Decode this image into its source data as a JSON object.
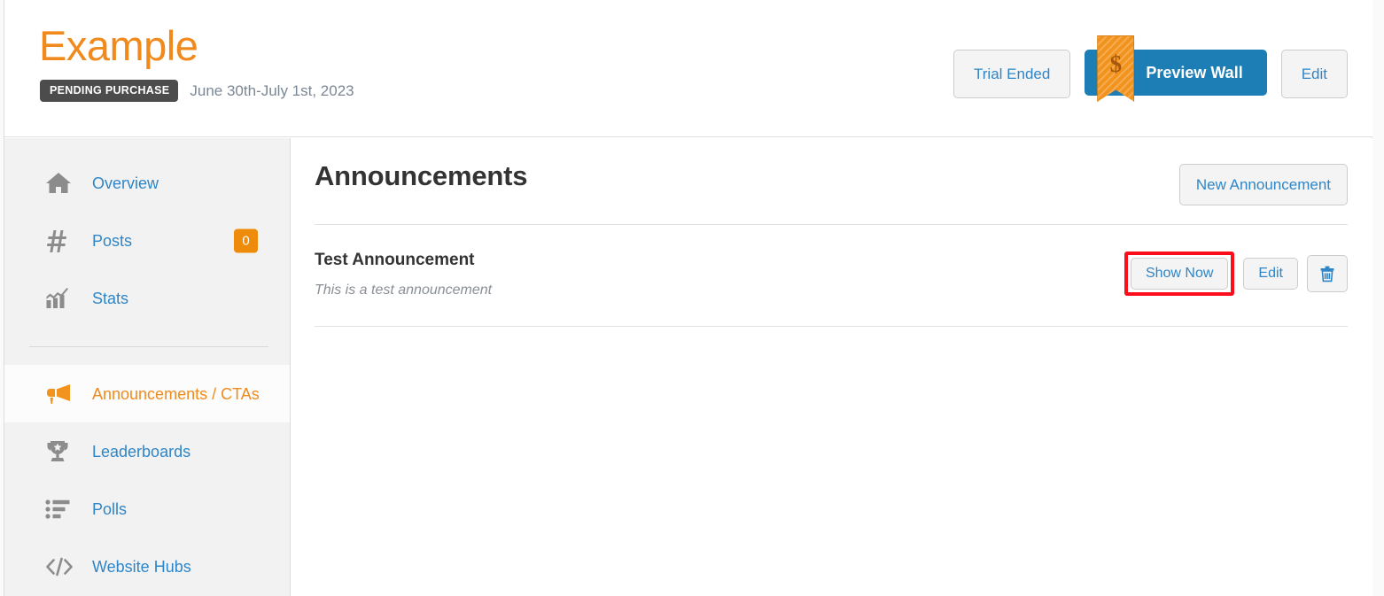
{
  "header": {
    "brand_title": "Example",
    "status_badge": "PENDING PURCHASE",
    "date_range": "June 30th-July 1st, 2023",
    "trial_button": "Trial Ended",
    "preview_button": "Preview Wall",
    "preview_ribbon_symbol": "$",
    "edit_button": "Edit"
  },
  "sidebar": {
    "items": [
      {
        "label": "Overview",
        "icon": "home-icon",
        "badge": null,
        "active": false
      },
      {
        "label": "Posts",
        "icon": "hashtag-icon",
        "badge": "0",
        "active": false
      },
      {
        "label": "Stats",
        "icon": "bar-chart-icon",
        "badge": null,
        "active": false
      },
      {
        "label": "Announcements / CTAs",
        "icon": "megaphone-icon",
        "badge": null,
        "active": true
      },
      {
        "label": "Leaderboards",
        "icon": "trophy-icon",
        "badge": null,
        "active": false
      },
      {
        "label": "Polls",
        "icon": "list-icon",
        "badge": null,
        "active": false
      },
      {
        "label": "Website Hubs",
        "icon": "code-icon",
        "badge": null,
        "active": false
      }
    ]
  },
  "main": {
    "title": "Announcements",
    "new_button": "New Announcement",
    "announcements": [
      {
        "title": "Test Announcement",
        "description": "This is a test announcement",
        "show_now_button": "Show Now",
        "edit_button": "Edit",
        "delete_icon": "trash-icon"
      }
    ]
  },
  "colors": {
    "brand_orange": "#f08a1c",
    "link_blue": "#2e86c8",
    "primary_blue": "#1d7db5",
    "badge_orange": "#ef8b0b",
    "highlight_red": "#fc0d1c",
    "status_dark": "#4c4c4c"
  }
}
